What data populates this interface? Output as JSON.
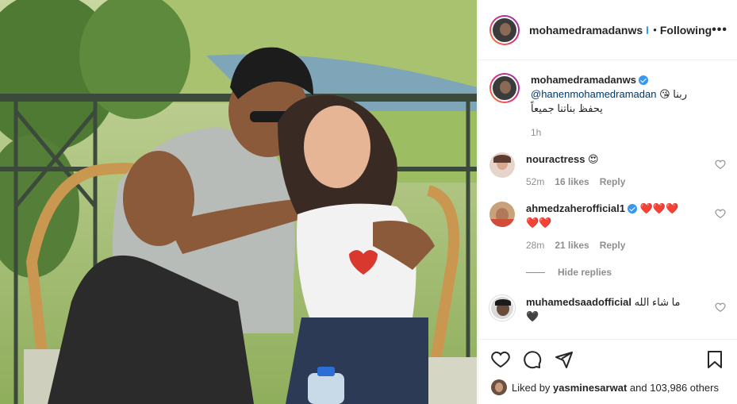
{
  "post": {
    "username": "mohamedramadanws",
    "separator": "•",
    "follow_status": "Following",
    "more_label": "•••"
  },
  "caption": {
    "username": "mohamedramadanws",
    "mention": "@hanenmohamedramadan",
    "text_line1": "ربنا",
    "emoji": "😘",
    "text_line2": "يحفظ بناتنا جميعاً",
    "time": "1h"
  },
  "comments": [
    {
      "username": "nouractress",
      "text": "😍",
      "time": "52m",
      "likes": "16 likes",
      "reply": "Reply",
      "verified": false
    },
    {
      "username": "ahmedzaherofficial1",
      "text": "❤️❤️❤️",
      "text2": "❤️❤️",
      "time": "28m",
      "likes": "21 likes",
      "reply": "Reply",
      "verified": true
    },
    {
      "username": "muhamedsaadofficial",
      "text": "ما شاء الله",
      "text2": "🖤",
      "verified": false
    }
  ],
  "hide_replies": "Hide replies",
  "liked": {
    "prefix": "Liked by",
    "user": "yasminesarwat",
    "suffix": "and 103,986 others"
  },
  "icons": [
    "heart-icon",
    "comment-icon",
    "share-icon",
    "bookmark-icon"
  ]
}
